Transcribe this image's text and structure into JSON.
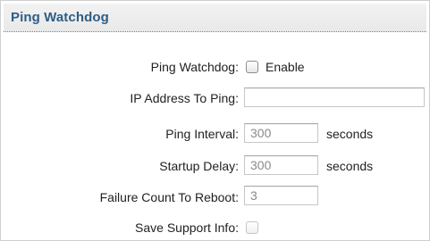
{
  "section": {
    "title": "Ping Watchdog"
  },
  "fields": {
    "ping_watchdog": {
      "label": "Ping Watchdog:",
      "checkbox_label": "Enable",
      "checked": false
    },
    "ip_address": {
      "label": "IP Address To Ping:",
      "value": ""
    },
    "ping_interval": {
      "label": "Ping Interval:",
      "value": "300",
      "unit": "seconds"
    },
    "startup_delay": {
      "label": "Startup Delay:",
      "value": "300",
      "unit": "seconds"
    },
    "failure_count": {
      "label": "Failure Count To Reboot:",
      "value": "3"
    },
    "save_support_info": {
      "label": "Save Support Info:",
      "checked": false,
      "disabled": true
    }
  },
  "colors": {
    "title": "#2e5d84",
    "header_bg": "#eeeeee",
    "text": "#222222",
    "input_text": "#8a8a8a"
  }
}
